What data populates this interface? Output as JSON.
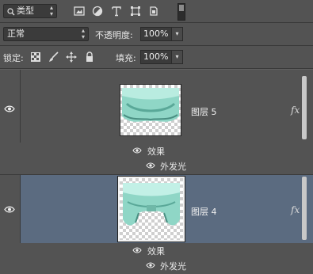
{
  "filter_bar": {
    "kind_label": "类型",
    "icons": [
      "image-filter-icon",
      "adjustment-filter-icon",
      "type-filter-icon",
      "shape-filter-icon",
      "smart-object-filter-icon"
    ]
  },
  "blend_bar": {
    "blend_mode": "正常",
    "opacity_label": "不透明度:",
    "opacity_value": "100%"
  },
  "lock_bar": {
    "lock_label": "锁定:",
    "fill_label": "填充:",
    "fill_value": "100%"
  },
  "layers": [
    {
      "name": "图层 5",
      "fx": "fx",
      "effects_label": "效果",
      "effect": "外发光",
      "selected": false
    },
    {
      "name": "图层 4",
      "fx": "fx",
      "effects_label": "效果",
      "effect": "外发光",
      "selected": true
    }
  ],
  "colors": {
    "panel_bg": "#535353",
    "selected_bg": "#5b6b80",
    "field_bg": "#3b3b3b"
  }
}
